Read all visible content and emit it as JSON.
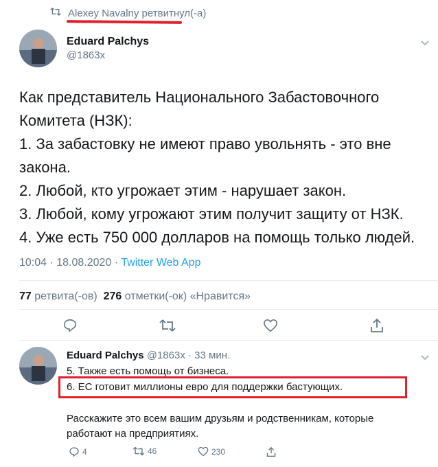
{
  "retweet_banner": {
    "icon": "retweet-icon",
    "text": "Alexey Navalny ретвитнул(-а)"
  },
  "tweet": {
    "author_name": "Eduard Palchys",
    "author_handle": "@1863x",
    "lines": [
      "Как представитель Национального Забастовочного",
      "Комитета (НЗК):",
      "1. За забастовку не имеют право увольнять - это вне",
      "закона.",
      "2. Любой, кто угрожает этим - нарушает закон.",
      "3. Любой, кому угрожают этим получит защиту от НЗК.",
      "4. Уже есть 750 000 долларов на помощь только людей."
    ],
    "timestamp": "10:04 · 18.08.2020 · ",
    "source": "Twitter Web App",
    "retweets_count": "77",
    "retweets_label": "ретвита(-ов)",
    "likes_count": "276",
    "likes_label": "отметки(-ок) «Нравится»"
  },
  "reply": {
    "author_name": "Eduard Palchys",
    "author_handle": "@1863x",
    "time": "· 33 мин.",
    "line1": "5. Также есть помощь от бизнеса.",
    "line2": "6. ЕС готовит миллионы евро для поддержки бастующих.",
    "line3": "Расскажите это всем вашим друзьям и родственникам, которые",
    "line4": "работают на предприятиях.",
    "reply_count": "4",
    "retweet_count": "46",
    "like_count": "230"
  },
  "colors": {
    "accent": "#1da1f2",
    "highlight": "#e0202b",
    "muted": "#657786"
  }
}
